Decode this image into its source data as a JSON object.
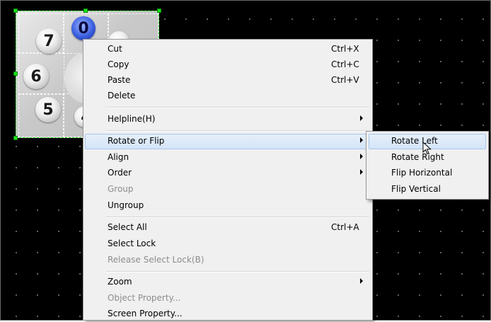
{
  "canvas": {
    "background": "#000000",
    "dot_color": "#7a7a7a"
  },
  "keypad": {
    "keys": [
      "7",
      "0",
      "6",
      "5",
      "4"
    ],
    "arrow_glyph": "↑",
    "selection_color": "#19e619",
    "active_key_color": "#3a5fe0"
  },
  "context_menu": {
    "items": [
      {
        "label": "Cut",
        "shortcut": "Ctrl+X"
      },
      {
        "label": "Copy",
        "shortcut": "Ctrl+C"
      },
      {
        "label": "Paste",
        "shortcut": "Ctrl+V"
      },
      {
        "label": "Delete"
      },
      {
        "label": "Helpline(H)"
      },
      {
        "label": "Rotate or Flip"
      },
      {
        "label": "Align"
      },
      {
        "label": "Order"
      },
      {
        "label": "Group"
      },
      {
        "label": "Ungroup"
      },
      {
        "label": "Select All",
        "shortcut": "Ctrl+A"
      },
      {
        "label": "Select Lock"
      },
      {
        "label": "Release Select Lock(B)"
      },
      {
        "label": "Zoom"
      },
      {
        "label": "Object Property..."
      },
      {
        "label": "Screen Property..."
      }
    ]
  },
  "submenu": {
    "items": [
      {
        "label": "Rotate Left"
      },
      {
        "label": "Rotate Right"
      },
      {
        "label": "Flip Horizontal"
      },
      {
        "label": "Flip Vertical"
      }
    ]
  },
  "colors": {
    "highlight": "#d4e4f7",
    "highlight_border": "#a8c8ee",
    "disabled_text": "#8d8d8d",
    "menu_bg": "#f0f0f0"
  }
}
